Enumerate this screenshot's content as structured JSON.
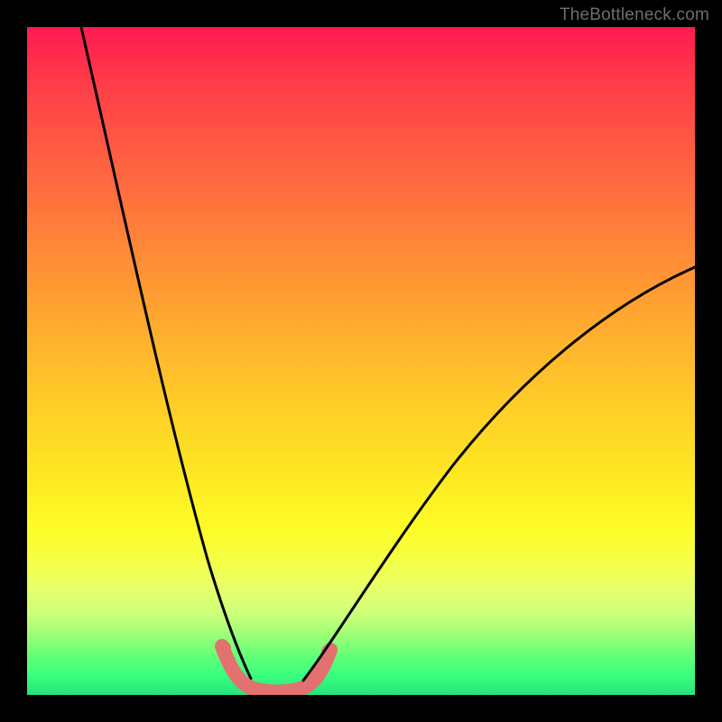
{
  "watermark": {
    "text": "TheBottleneck.com"
  },
  "chart_data": {
    "type": "line",
    "title": "",
    "xlabel": "",
    "ylabel": "",
    "xlim": [
      0,
      100
    ],
    "ylim": [
      0,
      100
    ],
    "grid": false,
    "legend": false,
    "annotations": [],
    "background_gradient_stops": [
      {
        "pct": 0,
        "color": "#ff1a50"
      },
      {
        "pct": 10,
        "color": "#ff4248"
      },
      {
        "pct": 25,
        "color": "#ff6f3e"
      },
      {
        "pct": 40,
        "color": "#ff9d32"
      },
      {
        "pct": 55,
        "color": "#ffc928"
      },
      {
        "pct": 68,
        "color": "#feea22"
      },
      {
        "pct": 75,
        "color": "#fdfd26"
      },
      {
        "pct": 80,
        "color": "#f4ff47"
      },
      {
        "pct": 84,
        "color": "#e8ff6a"
      },
      {
        "pct": 88,
        "color": "#cbff7a"
      },
      {
        "pct": 91,
        "color": "#9bff76"
      },
      {
        "pct": 94,
        "color": "#66ff78"
      },
      {
        "pct": 97,
        "color": "#3aff7c"
      },
      {
        "pct": 100,
        "color": "#26e47d"
      }
    ],
    "series": [
      {
        "name": "left-branch",
        "stroke": "#000000",
        "values": [
          {
            "x": 8,
            "y": 100
          },
          {
            "x": 12,
            "y": 80
          },
          {
            "x": 16,
            "y": 62
          },
          {
            "x": 20,
            "y": 45
          },
          {
            "x": 24,
            "y": 28
          },
          {
            "x": 27,
            "y": 15
          },
          {
            "x": 30,
            "y": 6
          },
          {
            "x": 33,
            "y": 1
          }
        ]
      },
      {
        "name": "trough-band",
        "stroke": "#e2716f",
        "values": [
          {
            "x": 29,
            "y": 6
          },
          {
            "x": 30,
            "y": 3
          },
          {
            "x": 33,
            "y": 0.5
          },
          {
            "x": 37,
            "y": 0.5
          },
          {
            "x": 40,
            "y": 0.5
          },
          {
            "x": 43,
            "y": 3
          },
          {
            "x": 44,
            "y": 6
          }
        ]
      },
      {
        "name": "right-branch",
        "stroke": "#000000",
        "values": [
          {
            "x": 41,
            "y": 1
          },
          {
            "x": 45,
            "y": 7
          },
          {
            "x": 52,
            "y": 18
          },
          {
            "x": 60,
            "y": 30
          },
          {
            "x": 70,
            "y": 42
          },
          {
            "x": 80,
            "y": 52
          },
          {
            "x": 90,
            "y": 59
          },
          {
            "x": 100,
            "y": 64
          }
        ]
      }
    ]
  }
}
